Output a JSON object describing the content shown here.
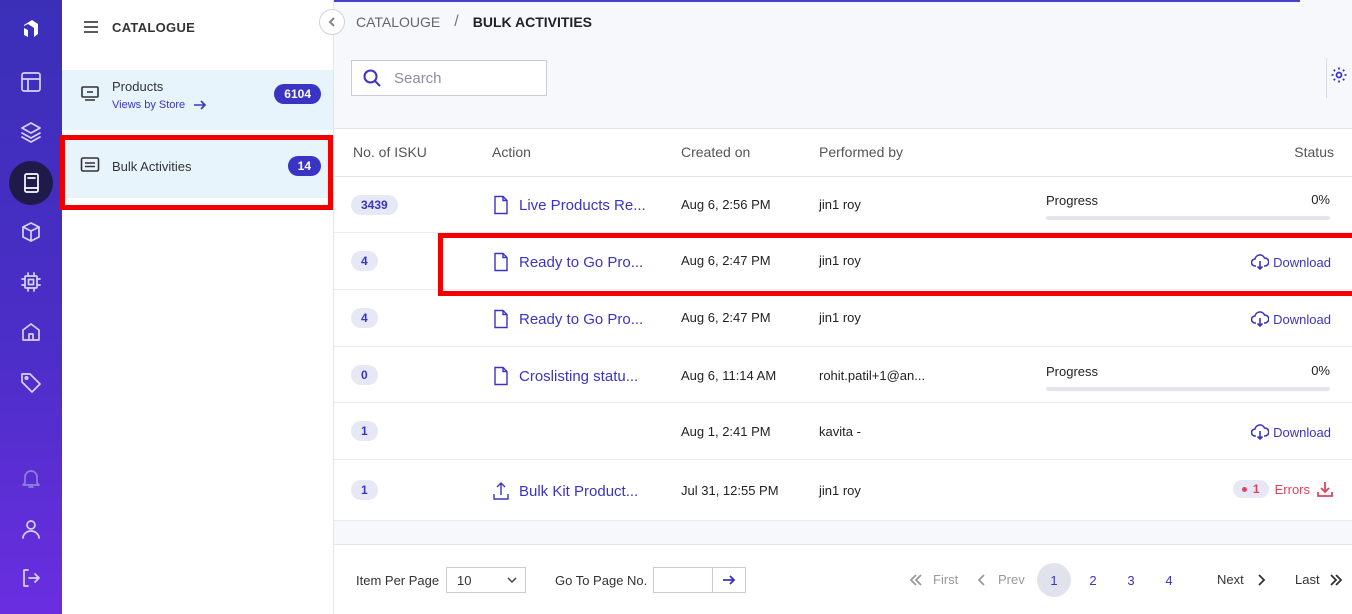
{
  "sidebar": {
    "title": "CATALOGUE",
    "items": [
      {
        "label": "Products",
        "sublink": "Views by Store",
        "count": "6104"
      },
      {
        "label": "Bulk Activities",
        "count": "14"
      }
    ]
  },
  "breadcrumb": {
    "parent": "CATALOUGE",
    "separator": "/",
    "current": "BULK ACTIVITIES"
  },
  "search": {
    "placeholder": "Search"
  },
  "table": {
    "headers": {
      "isku": "No. of ISKU",
      "action": "Action",
      "created": "Created on",
      "performed": "Performed by",
      "status": "Status"
    },
    "rows": [
      {
        "isku": "3439",
        "action": "Live Products Re...",
        "created": "Aug 6, 2:56 PM",
        "performed": "jin1 roy",
        "status_label": "Progress",
        "status_value": "0%",
        "progress": 0
      },
      {
        "isku": "4",
        "action": "Ready to Go Pro...",
        "created": "Aug 6, 2:47 PM",
        "performed": "jin1 roy",
        "status_label": "Download"
      },
      {
        "isku": "4",
        "action": "Ready to Go Pro...",
        "created": "Aug 6, 2:47 PM",
        "performed": "jin1 roy",
        "status_label": "Download"
      },
      {
        "isku": "0",
        "action": "Croslisting statu...",
        "created": "Aug 6, 11:14 AM",
        "performed": "rohit.patil+1@an...",
        "status_label": "Progress",
        "status_value": "0%",
        "progress": 0
      },
      {
        "isku": "1",
        "action": "",
        "created": "Aug 1, 2:41 PM",
        "performed": "kavita -",
        "status_label": "Download"
      },
      {
        "isku": "1",
        "action": "Bulk Kit Product...",
        "created": "Jul 31, 12:55 PM",
        "performed": "jin1 roy",
        "error_count": "1",
        "status_label": "Errors"
      }
    ]
  },
  "footer": {
    "per_page_label": "Item Per Page",
    "per_page_value": "10",
    "goto_label": "Go To Page No.",
    "first": "First",
    "prev": "Prev",
    "pages": [
      "1",
      "2",
      "3",
      "4"
    ],
    "current_page": "1",
    "next": "Next",
    "last": "Last"
  },
  "colors": {
    "accent": "#3a34c4",
    "error": "#e0445a",
    "highlight": "#f20000"
  }
}
